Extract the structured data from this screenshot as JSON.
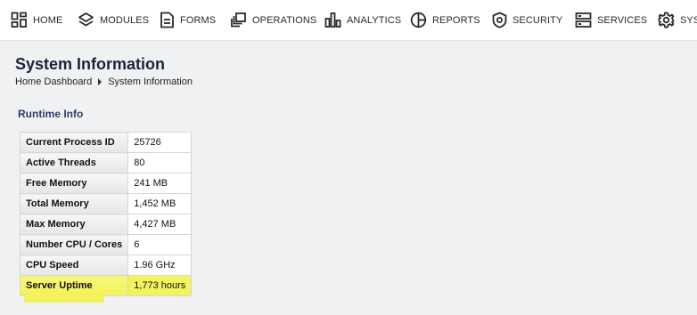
{
  "nav": {
    "items": [
      {
        "label": "HOME",
        "icon": "home-icon"
      },
      {
        "label": "MODULES",
        "icon": "modules-icon"
      },
      {
        "label": "FORMS",
        "icon": "forms-icon"
      },
      {
        "label": "OPERATIONS",
        "icon": "operations-icon"
      },
      {
        "label": "ANALYTICS",
        "icon": "analytics-icon"
      },
      {
        "label": "REPORTS",
        "icon": "reports-icon"
      },
      {
        "label": "SECURITY",
        "icon": "security-icon"
      },
      {
        "label": "SERVICES",
        "icon": "services-icon"
      },
      {
        "label": "SYS",
        "icon": "gear-icon"
      }
    ]
  },
  "page": {
    "title": "System Information",
    "breadcrumb": [
      "Home Dashboard",
      "System Information"
    ]
  },
  "runtime": {
    "section_title": "Runtime Info",
    "rows": [
      {
        "key": "Current Process ID",
        "value": "25726"
      },
      {
        "key": "Active Threads",
        "value": "80"
      },
      {
        "key": "Free Memory",
        "value": "241 MB"
      },
      {
        "key": "Total Memory",
        "value": "1,452 MB"
      },
      {
        "key": "Max Memory",
        "value": "4,427 MB"
      },
      {
        "key": "Number CPU / Cores",
        "value": "6"
      },
      {
        "key": "CPU Speed",
        "value": "1.96 GHz"
      },
      {
        "key": "Server Uptime",
        "value": "1,773 hours"
      }
    ]
  },
  "colors": {
    "highlight": "#f2f25a",
    "title": "#1c2340",
    "section_title": "#2c3e6a",
    "content_bg": "#f0f1f3"
  }
}
